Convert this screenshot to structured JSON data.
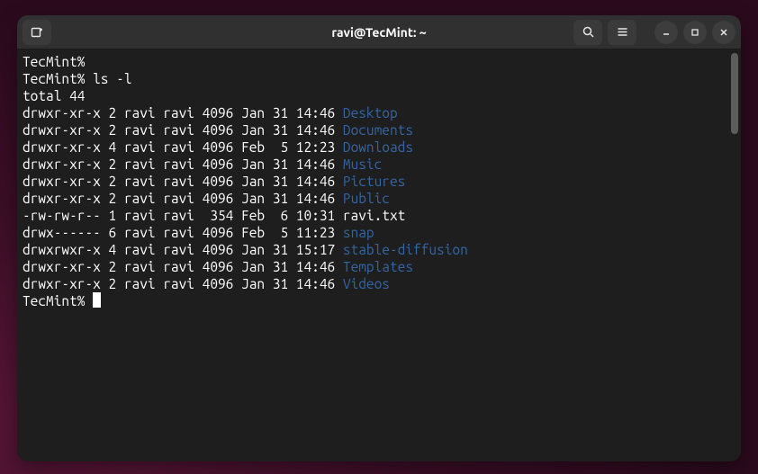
{
  "titlebar": {
    "title": "ravi@TecMint: ~"
  },
  "terminal": {
    "prompt": "TecMint%",
    "history": [
      {
        "type": "prompt_only"
      },
      {
        "type": "command",
        "command": "ls -l"
      },
      {
        "type": "output_plain",
        "text": "total 44"
      },
      {
        "type": "listing",
        "rows": [
          {
            "perms": "drwxr-xr-x",
            "links": "2",
            "owner": "ravi",
            "group": "ravi",
            "size": "4096",
            "month": "Jan",
            "day": "31",
            "time": "14:46",
            "name": "Desktop",
            "is_dir": true
          },
          {
            "perms": "drwxr-xr-x",
            "links": "2",
            "owner": "ravi",
            "group": "ravi",
            "size": "4096",
            "month": "Jan",
            "day": "31",
            "time": "14:46",
            "name": "Documents",
            "is_dir": true
          },
          {
            "perms": "drwxr-xr-x",
            "links": "4",
            "owner": "ravi",
            "group": "ravi",
            "size": "4096",
            "month": "Feb",
            "day": " 5",
            "time": "12:23",
            "name": "Downloads",
            "is_dir": true
          },
          {
            "perms": "drwxr-xr-x",
            "links": "2",
            "owner": "ravi",
            "group": "ravi",
            "size": "4096",
            "month": "Jan",
            "day": "31",
            "time": "14:46",
            "name": "Music",
            "is_dir": true
          },
          {
            "perms": "drwxr-xr-x",
            "links": "2",
            "owner": "ravi",
            "group": "ravi",
            "size": "4096",
            "month": "Jan",
            "day": "31",
            "time": "14:46",
            "name": "Pictures",
            "is_dir": true
          },
          {
            "perms": "drwxr-xr-x",
            "links": "2",
            "owner": "ravi",
            "group": "ravi",
            "size": "4096",
            "month": "Jan",
            "day": "31",
            "time": "14:46",
            "name": "Public",
            "is_dir": true
          },
          {
            "perms": "-rw-rw-r--",
            "links": "1",
            "owner": "ravi",
            "group": "ravi",
            "size": " 354",
            "month": "Feb",
            "day": " 6",
            "time": "10:31",
            "name": "ravi.txt",
            "is_dir": false
          },
          {
            "perms": "drwx------",
            "links": "6",
            "owner": "ravi",
            "group": "ravi",
            "size": "4096",
            "month": "Feb",
            "day": " 5",
            "time": "11:23",
            "name": "snap",
            "is_dir": true
          },
          {
            "perms": "drwxrwxr-x",
            "links": "4",
            "owner": "ravi",
            "group": "ravi",
            "size": "4096",
            "month": "Jan",
            "day": "31",
            "time": "15:17",
            "name": "stable-diffusion",
            "is_dir": true
          },
          {
            "perms": "drwxr-xr-x",
            "links": "2",
            "owner": "ravi",
            "group": "ravi",
            "size": "4096",
            "month": "Jan",
            "day": "31",
            "time": "14:46",
            "name": "Templates",
            "is_dir": true
          },
          {
            "perms": "drwxr-xr-x",
            "links": "2",
            "owner": "ravi",
            "group": "ravi",
            "size": "4096",
            "month": "Jan",
            "day": "31",
            "time": "14:46",
            "name": "Videos",
            "is_dir": true
          }
        ]
      },
      {
        "type": "prompt_cursor"
      }
    ]
  }
}
